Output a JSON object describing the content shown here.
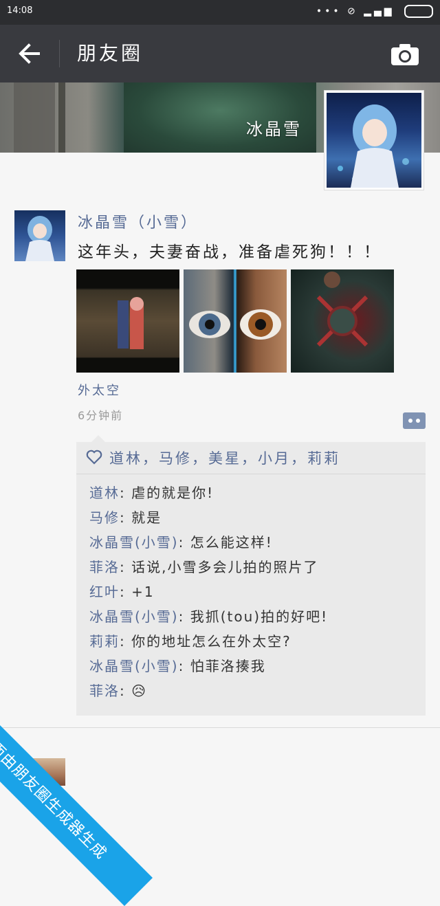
{
  "status_bar": {
    "time": "14:08",
    "icons": "•••"
  },
  "header": {
    "title": "朋友圈"
  },
  "cover": {
    "name": "冰晶雪"
  },
  "post": {
    "nickname": "冰晶雪（小雪）",
    "text": "这年头，夫妻奋战，准备虐死狗！！！",
    "photos": [
      "photo-1",
      "photo-2",
      "photo-3"
    ],
    "location": "外太空",
    "time": "6分钟前",
    "likes": "道林，马修，美星，小月，莉莉",
    "comments": [
      {
        "name": "道林",
        "text": ": 虐的就是你!"
      },
      {
        "name": "马修",
        "text": ": 就是"
      },
      {
        "name": "冰晶雪(小雪)",
        "text": ": 怎么能这样!"
      },
      {
        "name": "菲洛",
        "text": ": 话说,小雪多会儿拍的照片了"
      },
      {
        "name": "红叶",
        "text": ": +1"
      },
      {
        "name": "冰晶雪(小雪)",
        "text": ": 我抓(tou)拍的好吧!"
      },
      {
        "name": "莉莉",
        "text": ": 你的地址怎么在外太空?"
      },
      {
        "name": "冰晶雪(小雪)",
        "text": ": 怕菲洛揍我"
      },
      {
        "name": "菲洛",
        "text": ": 😥"
      }
    ]
  },
  "watermark": "本页面由朋友圈生成器生成",
  "colors": {
    "link": "#576b95",
    "titlebar": "#393a3f",
    "watermark": "#1aa3e8"
  }
}
